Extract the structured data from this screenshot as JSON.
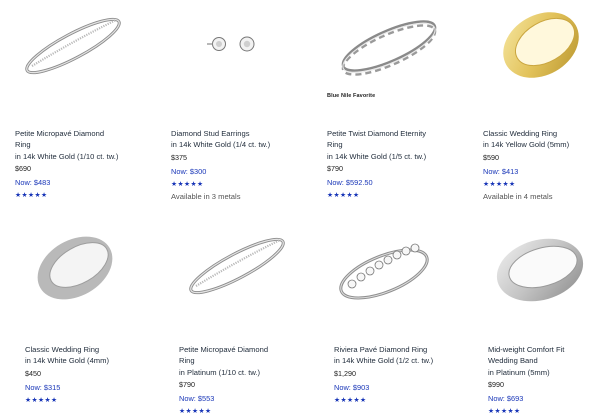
{
  "products": [
    {
      "name_lines": [
        "Petite Micropavé Diamond",
        "Ring",
        "in 14k White Gold (1/10 ct. tw.)"
      ],
      "price": "$690",
      "sale": "Now: $483",
      "stars": "★★★★★",
      "image_icon": "pave-band-icon"
    },
    {
      "name_lines": [
        "Diamond Stud Earrings",
        "in 14k White Gold (1/4 ct. tw.)"
      ],
      "price": "$375",
      "sale": "Now: $300",
      "stars": "★★★★★",
      "metals": "Available in 3 metals",
      "image_icon": "stud-earrings-icon"
    },
    {
      "name_lines": [
        "Petite Twist Diamond Eternity",
        "Ring",
        "in 14k White Gold (1/5 ct. tw.)"
      ],
      "price": "$790",
      "sale": "Now: $592.50",
      "stars": "★★★★★",
      "badge": "Blue Nile Favorite",
      "image_icon": "twist-ring-icon"
    },
    {
      "name_lines": [
        "Classic Wedding Ring",
        "in 14k Yellow Gold (5mm)"
      ],
      "price": "$590",
      "sale": "Now: $413",
      "stars": "★★★★★",
      "metals": "Available in 4 metals",
      "image_icon": "gold-band-icon"
    },
    {
      "name_lines": [
        "Classic Wedding Ring",
        "in 14k White Gold (4mm)"
      ],
      "price": "$450",
      "sale": "Now: $315",
      "stars": "★★★★★",
      "image_icon": "white-band-icon"
    },
    {
      "name_lines": [
        "Petite Micropavé Diamond",
        "Ring",
        "in Platinum (1/10 ct. tw.)"
      ],
      "price": "$790",
      "sale": "Now: $553",
      "stars": "★★★★★",
      "image_icon": "pave-band-icon"
    },
    {
      "name_lines": [
        "Riviera Pavé Diamond Ring",
        "in 14k White Gold (1/2 ct. tw.)"
      ],
      "price": "$1,290",
      "sale": "Now: $903",
      "stars": "★★★★★",
      "image_icon": "riviera-ring-icon"
    },
    {
      "name_lines": [
        "Mid-weight Comfort Fit",
        "Wedding Band",
        "in Platinum (5mm)"
      ],
      "price": "$990",
      "sale": "Now: $693",
      "stars": "★★★★★",
      "image_icon": "comfort-band-icon"
    }
  ]
}
